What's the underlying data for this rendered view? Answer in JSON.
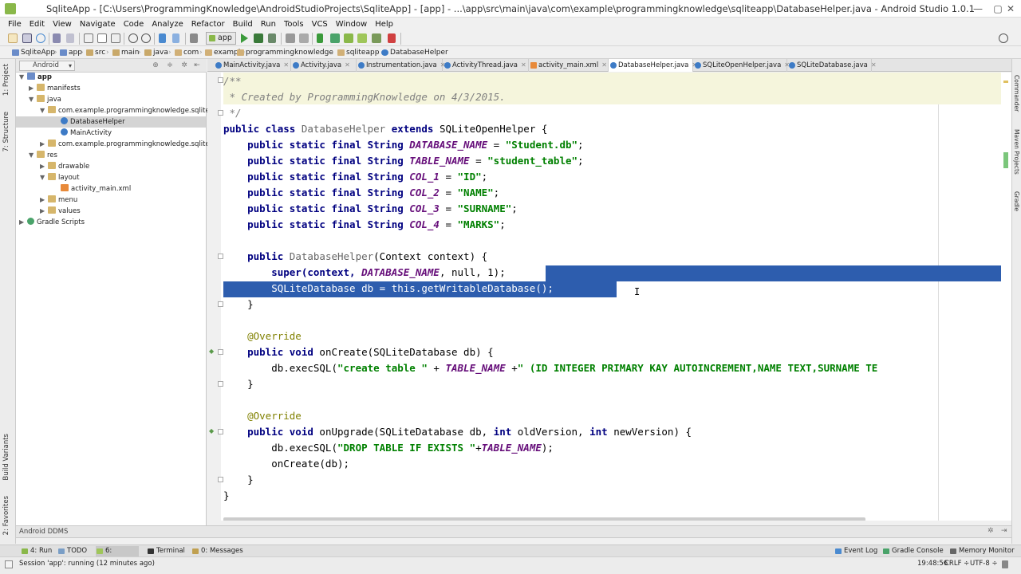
{
  "window": {
    "title": "SqliteApp - [C:\\Users\\ProgrammingKnowledge\\AndroidStudioProjects\\SqliteApp] - [app] - ...\\app\\src\\main\\java\\com\\example\\programmingknowledge\\sqliteapp\\DatabaseHelper.java - Android Studio 1.0.1",
    "minimize": "—",
    "maximize": "▢",
    "close": "✕"
  },
  "menu": [
    "File",
    "Edit",
    "View",
    "Navigate",
    "Code",
    "Analyze",
    "Refactor",
    "Build",
    "Run",
    "Tools",
    "VCS",
    "Window",
    "Help"
  ],
  "toolbar": {
    "run_config": "app"
  },
  "breadcrumb": [
    "SqliteApp",
    "app",
    "src",
    "main",
    "java",
    "com",
    "example",
    "programmingknowledge",
    "sqliteapp",
    "DatabaseHelper"
  ],
  "project_panel": {
    "view_mode": "Android",
    "tree": [
      {
        "label": "app",
        "icon": "module"
      },
      {
        "label": "manifests",
        "icon": "folder"
      },
      {
        "label": "java",
        "icon": "folder"
      },
      {
        "label": "com.example.programmingknowledge.sqliteapp",
        "icon": "package"
      },
      {
        "label": "DatabaseHelper",
        "icon": "class"
      },
      {
        "label": "MainActivity",
        "icon": "class"
      },
      {
        "label": "com.example.programmingknowledge.sqliteapp (",
        "icon": "package"
      },
      {
        "label": "res",
        "icon": "folder"
      },
      {
        "label": "drawable",
        "icon": "folder"
      },
      {
        "label": "layout",
        "icon": "folder"
      },
      {
        "label": "activity_main.xml",
        "icon": "xml"
      },
      {
        "label": "menu",
        "icon": "folder"
      },
      {
        "label": "values",
        "icon": "folder"
      },
      {
        "label": "Gradle Scripts",
        "icon": "gradle"
      }
    ]
  },
  "editor_tabs": [
    {
      "label": "MainActivity.java",
      "type": "class"
    },
    {
      "label": "Activity.java",
      "type": "class"
    },
    {
      "label": "Instrumentation.java",
      "type": "class"
    },
    {
      "label": "ActivityThread.java",
      "type": "class"
    },
    {
      "label": "activity_main.xml",
      "type": "xml"
    },
    {
      "label": "DatabaseHelper.java",
      "type": "class",
      "active": true
    },
    {
      "label": "SQLiteOpenHelper.java",
      "type": "class"
    },
    {
      "label": "SQLiteDatabase.java",
      "type": "class"
    }
  ],
  "code": {
    "l1": "/**",
    "l2": " * Created by ProgrammingKnowledge on 4/3/2015.",
    "l3": " */",
    "l4_a": "public class ",
    "l4_b": "DatabaseHelper",
    "l4_c": " extends ",
    "l4_d": "SQLiteOpenHelper",
    "l4_e": " {",
    "decl_prefix": "    public static final String ",
    "f1_name": "DATABASE_NAME",
    "f1_val": "\"Student.db\"",
    "f2_name": "TABLE_NAME",
    "f2_val": "\"student_table\"",
    "f3_name": "COL_1",
    "f3_val": "\"ID\"",
    "f4_name": "COL_2",
    "f4_val": "\"NAME\"",
    "f5_name": "COL_3",
    "f5_val": "\"SURNAME\"",
    "f6_name": "COL_4",
    "f6_val": "\"MARKS\"",
    "ctor_a": "    public ",
    "ctor_b": "DatabaseHelper",
    "ctor_c": "(Context context) {",
    "super_a": "        super(context, ",
    "super_b": "DATABASE_NAME",
    "super_c": ", null, 1);",
    "getdb": "        SQLiteDatabase db = this.getWritableDatabase();",
    "close1": "    }",
    "override": "    @Override",
    "oncreate_a": "    public void ",
    "oncreate_b": "onCreate(SQLiteDatabase db) {",
    "exec1_a": "        db.execSQL(",
    "exec1_b": "\"create table \"",
    "exec1_c": " + ",
    "exec1_d": "TABLE_NAME",
    "exec1_e": " +",
    "exec1_f": "\" (ID INTEGER PRIMARY KAY AUTOINCREMENT,NAME TEXT,SURNAME TE",
    "close2": "    }",
    "override2": "    @Override",
    "onupgrade_a": "    public void ",
    "onupgrade_b": "onUpgrade(SQLiteDatabase db, ",
    "onupgrade_c": "int",
    "onupgrade_d": " oldVersion, ",
    "onupgrade_e": "int",
    "onupgrade_f": " newVersion) {",
    "exec2_a": "        db.execSQL(",
    "exec2_b": "\"DROP TABLE IF EXISTS \"",
    "exec2_c": "+",
    "exec2_d": "TABLE_NAME",
    "exec2_e": ");",
    "call_oncreate": "        onCreate(db);",
    "close3": "    }",
    "close4": "}"
  },
  "ddms_label": "Android DDMS",
  "bottom_tabs": [
    {
      "label": "4: Run"
    },
    {
      "label": "TODO"
    },
    {
      "label": "6: Android",
      "active": true
    },
    {
      "label": "Terminal"
    },
    {
      "label": "0: Messages"
    },
    {
      "label": "Event Log"
    },
    {
      "label": "Gradle Console"
    },
    {
      "label": "Memory Monitor"
    }
  ],
  "left_tool_tabs": [
    "1: Project",
    "7: Structure",
    "Build Variants",
    "2: Favorites"
  ],
  "right_tool_tabs": [
    "Commander",
    "Maven Projects",
    "Gradle"
  ],
  "status": {
    "message": "Session 'app': running (12 minutes ago)",
    "position": "19:48:56",
    "line_sep": "CRLF ÷",
    "encoding": "UTF-8 ÷"
  },
  "colors": {
    "selection": "#2d5dae",
    "keyword": "#000080",
    "field": "#660e7a",
    "string": "#008000",
    "comment": "#7f7f7f"
  }
}
